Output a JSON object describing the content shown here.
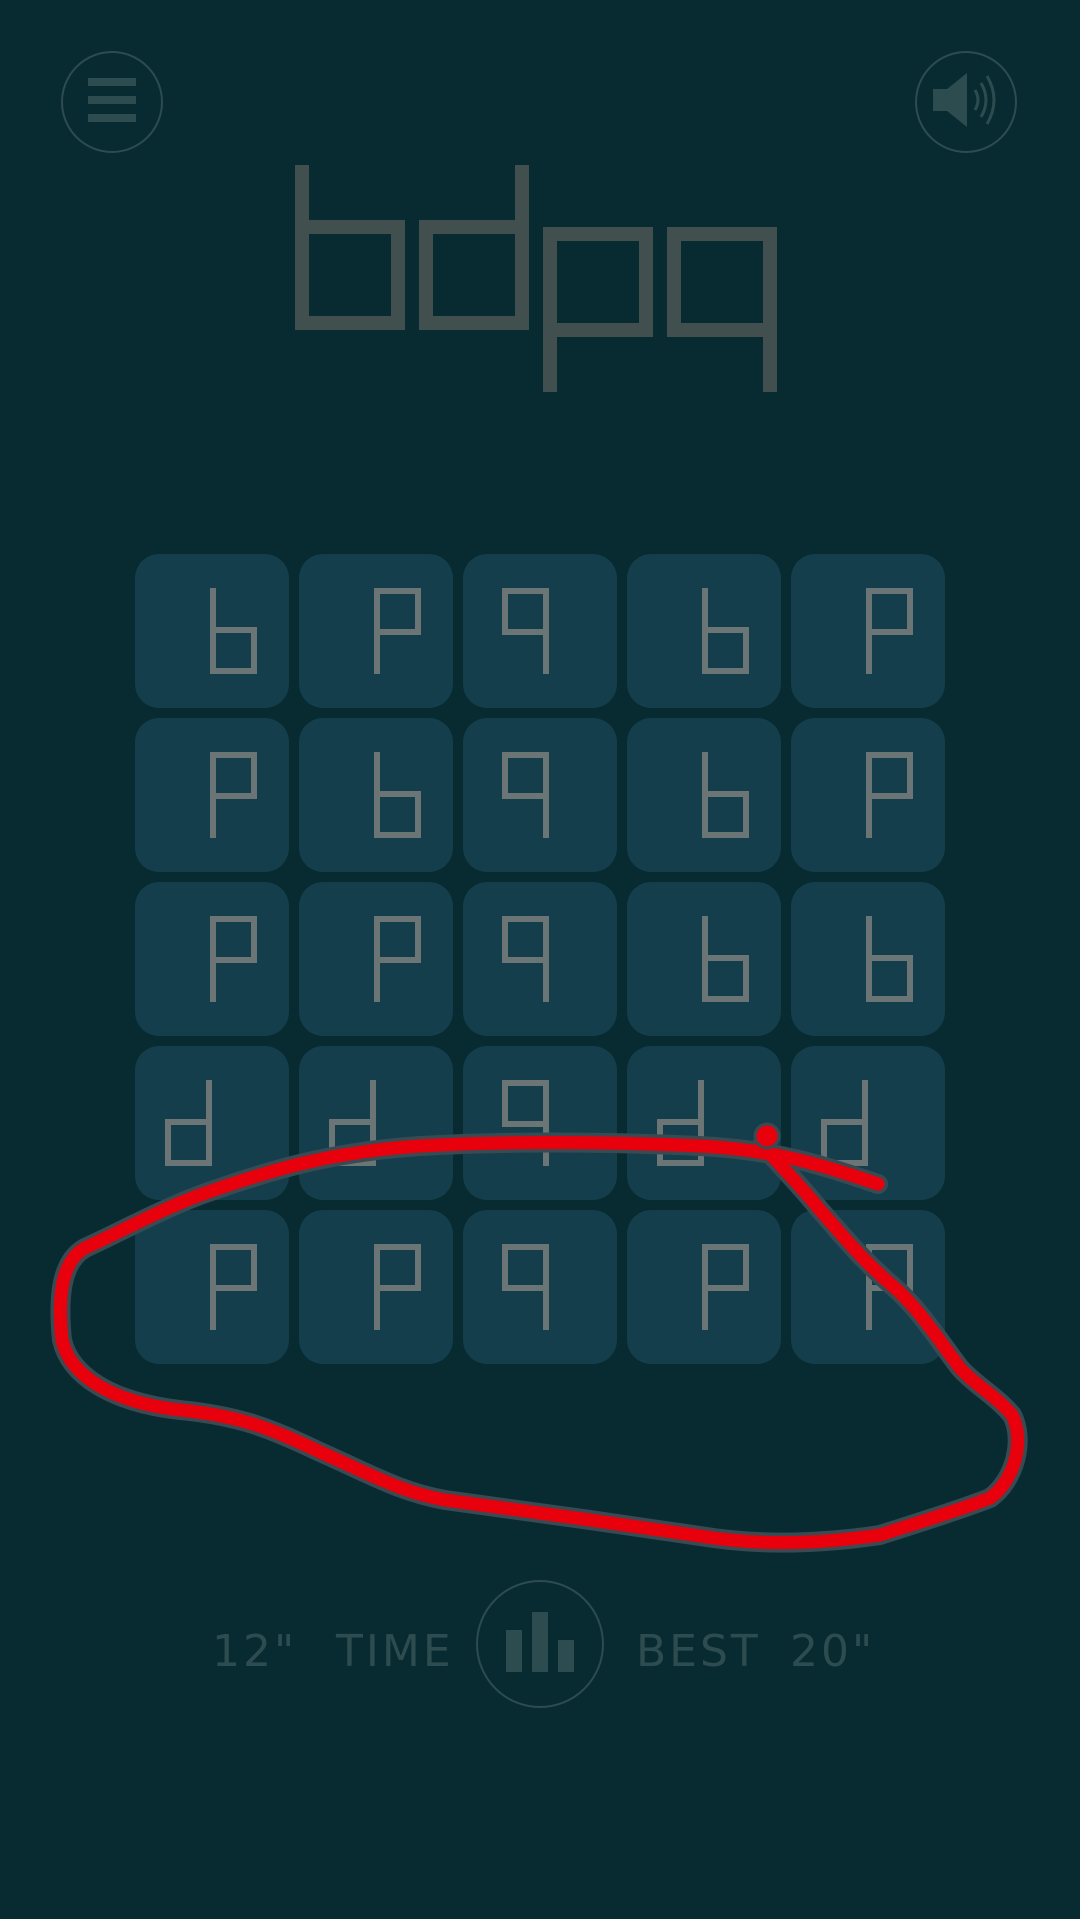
{
  "header": {
    "menu_icon": "hamburger-menu-icon",
    "sound_icon": "speaker-sound-icon",
    "logo_text": "bdpq"
  },
  "board": {
    "rows": [
      [
        "b",
        "p",
        "q",
        "b",
        "p"
      ],
      [
        "p",
        "b",
        "q",
        "b",
        "p"
      ],
      [
        "p",
        "p",
        "q",
        "b",
        "b"
      ],
      [
        "d",
        "d",
        "q",
        "d",
        "d"
      ],
      [
        "p",
        "p",
        "q",
        "p",
        "p"
      ]
    ]
  },
  "footer": {
    "current_time": "12\"",
    "time_label": "TIME",
    "best_label": "BEST",
    "best_time": "20\"",
    "stats_icon": "bar-chart-icon"
  },
  "colors": {
    "background": "#082a31",
    "tile": "#143e4c",
    "tile_glyph": "#6b7575",
    "logo": "#414f4f",
    "muted": "#2d4c4f",
    "annotation": "#e8000c"
  },
  "annotation": {
    "type": "freehand-loop",
    "target": "bottom tile row"
  }
}
